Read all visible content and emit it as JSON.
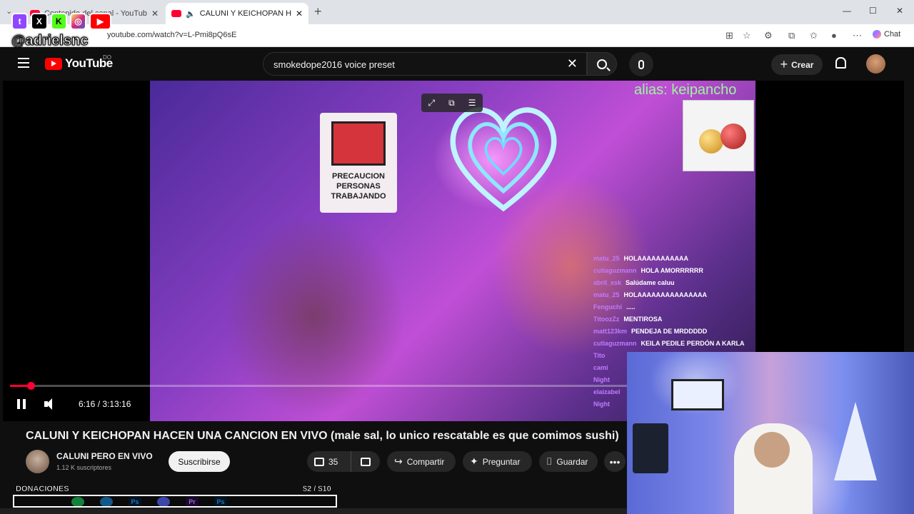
{
  "browser": {
    "tabs": [
      {
        "label": "Contenido del canal - YouTube Studio",
        "active": false
      },
      {
        "label": "CALUNI Y KEICHOPAN HACEN",
        "active": true
      }
    ],
    "url": "youtube.com/watch?v=L-Pmi8pQ6sE",
    "chat_label": "Chat"
  },
  "overlay": {
    "handle": "@adrielsnc",
    "icons": [
      "twitch-icon",
      "x-icon",
      "kick-icon",
      "instagram-icon",
      "youtube-icon"
    ],
    "donations_label": "DONACIONES",
    "donations_amount": "$2 / $10",
    "donations_progress": 0.2
  },
  "youtube": {
    "logo_text": "YouTube",
    "country_code": "DO",
    "search_query": "smokedope2016 voice preset",
    "create_label": "Crear"
  },
  "video": {
    "alias_text": "alias: keipancho",
    "sign_line1": "PRECAUCION",
    "sign_line2": "PERSONAS TRABAJANDO",
    "time": "6:16 / 3:13:16",
    "progress": 0.033,
    "chat": [
      {
        "user": "matu_25",
        "msg": "HOLAAAAAAAAAAA"
      },
      {
        "user": "cutiaguzmann",
        "msg": "HOLA AMORRRRRR"
      },
      {
        "user": "abril_xsk",
        "msg": "Salúdame caluu"
      },
      {
        "user": "matu_25",
        "msg": "HOLAAAAAAAAAAAAAAA"
      },
      {
        "user": "Fenguchi",
        "msg": "....."
      },
      {
        "user": "TitoozZz",
        "msg": "MENTIROSA"
      },
      {
        "user": "matt123km",
        "msg": "PENDEJA DE MRDDDDD"
      },
      {
        "user": "cutiaguzmann",
        "msg": "KEILA PEDILE PERDÓN A KARLA"
      },
      {
        "user": "Tito",
        "msg": ""
      },
      {
        "user": "cami",
        "msg": ""
      },
      {
        "user": "Night",
        "msg": ""
      },
      {
        "user": "elaizabel",
        "msg": ""
      },
      {
        "user": "Night",
        "msg": ""
      }
    ]
  },
  "meta": {
    "title": "CALUNI Y KEICHOPAN HACEN UNA CANCION EN VIVO (male sal, lo unico rescatable es que comimos sushi)",
    "channel_name": "CALUNI PERO EN VIVO",
    "subscribers": "1.12 K suscriptores",
    "subscribe_label": "Suscribirse",
    "likes": "35",
    "share_label": "Compartir",
    "ask_label": "Preguntar",
    "save_label": "Guardar"
  },
  "colors": {
    "accent": "#ff0033",
    "alias": "#9af79a",
    "chat_user": "#c07bff"
  }
}
